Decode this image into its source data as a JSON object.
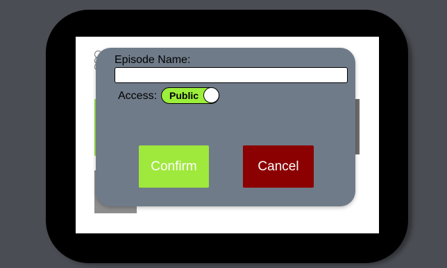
{
  "dialog": {
    "episode_label": "Episode Name:",
    "episode_value": "",
    "access_label": "Access:",
    "access_toggle": {
      "label": "Public",
      "on": true
    },
    "confirm_label": "Confirm",
    "cancel_label": "Cancel"
  },
  "colors": {
    "modal_background": "#6f7b89",
    "confirm_button": "#9fe83c",
    "cancel_button": "#8b0000",
    "toggle_on": "#9cef3a"
  }
}
